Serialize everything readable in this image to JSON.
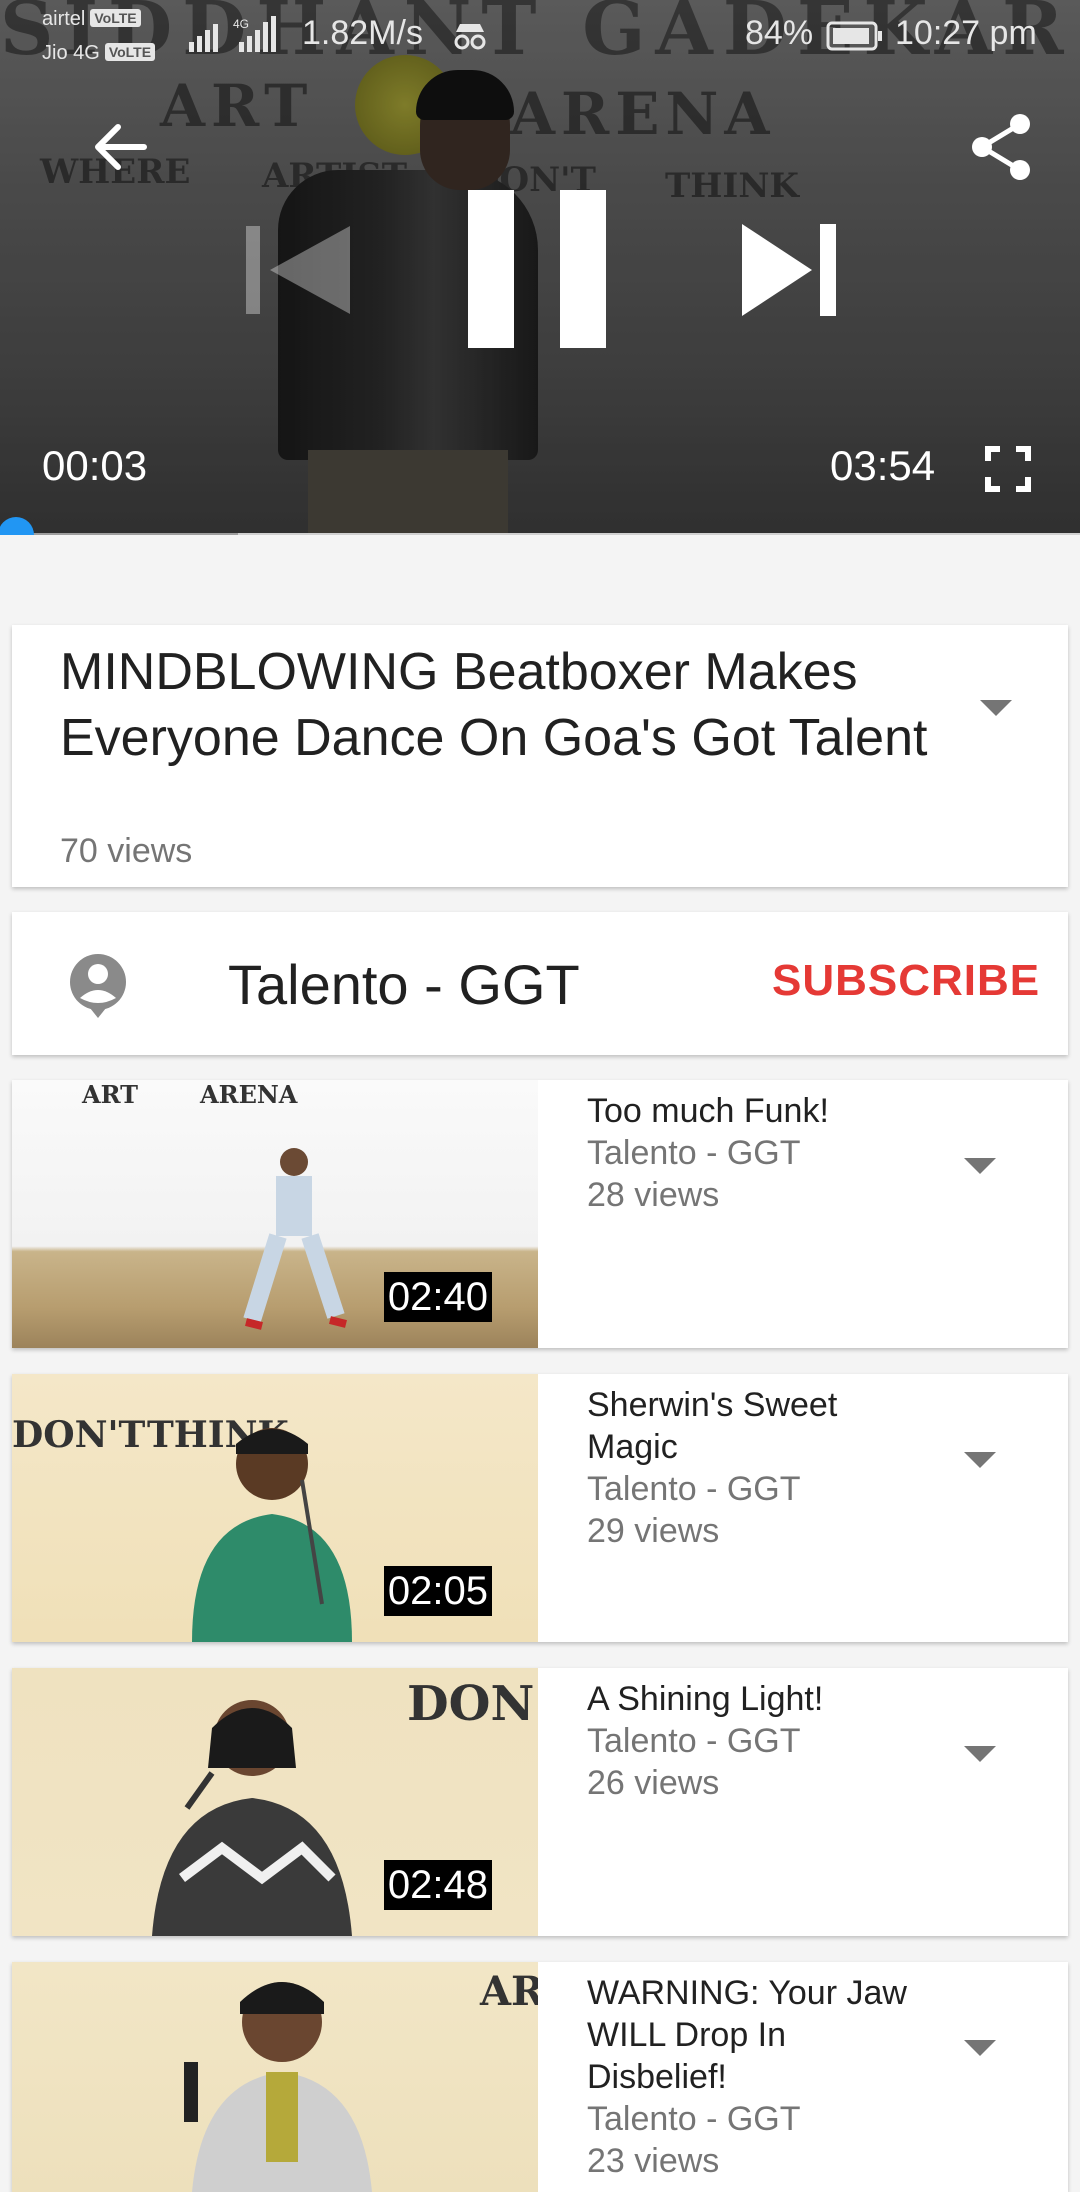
{
  "status_bar": {
    "operator_1": "airtel",
    "operator_1_badge": "VoLTE",
    "operator_2": "Jio 4G",
    "operator_2_badge": "VoLTE",
    "network_speed": "1.82M/s",
    "battery_percent": "84%",
    "time": "10:27 pm"
  },
  "player": {
    "current_time": "00:03",
    "duration": "03:54",
    "played_fraction": 0.013,
    "buffered_fraction": 0.22,
    "state": "playing",
    "accent_color": "#2196f3",
    "icons": [
      "back-arrow-icon",
      "share-icon",
      "previous-icon",
      "pause-icon",
      "next-icon",
      "fullscreen-icon"
    ]
  },
  "video": {
    "title": "MINDBLOWING Beatboxer Makes Everyone Dance On Goa's Got Talent",
    "views": "70 views"
  },
  "channel": {
    "name": "Talento - GGT",
    "subscribe_label": "SUBSCRIBE",
    "subscribe_color": "#e53935"
  },
  "related": [
    {
      "title": "Too much Funk!",
      "channel": "Talento - GGT",
      "views": "28 views",
      "duration": "02:40"
    },
    {
      "title": "Sherwin's Sweet Magic",
      "channel": "Talento - GGT",
      "views": "29 views",
      "duration": "02:05"
    },
    {
      "title": "A Shining Light!",
      "channel": "Talento - GGT",
      "views": "26 views",
      "duration": "02:48"
    },
    {
      "title": "WARNING: Your Jaw WILL Drop In Disbelief!",
      "channel": "Talento - GGT",
      "views": "23 views",
      "duration": ""
    }
  ],
  "backdrop_text": {
    "banner": "SIDDHANT GADEKAR",
    "brand_1": "ART",
    "brand_2": "ARENA",
    "tag_1": "WHERE",
    "tag_2": "ARTIST",
    "tag_3": "DON'T",
    "tag_4": "THINK"
  }
}
